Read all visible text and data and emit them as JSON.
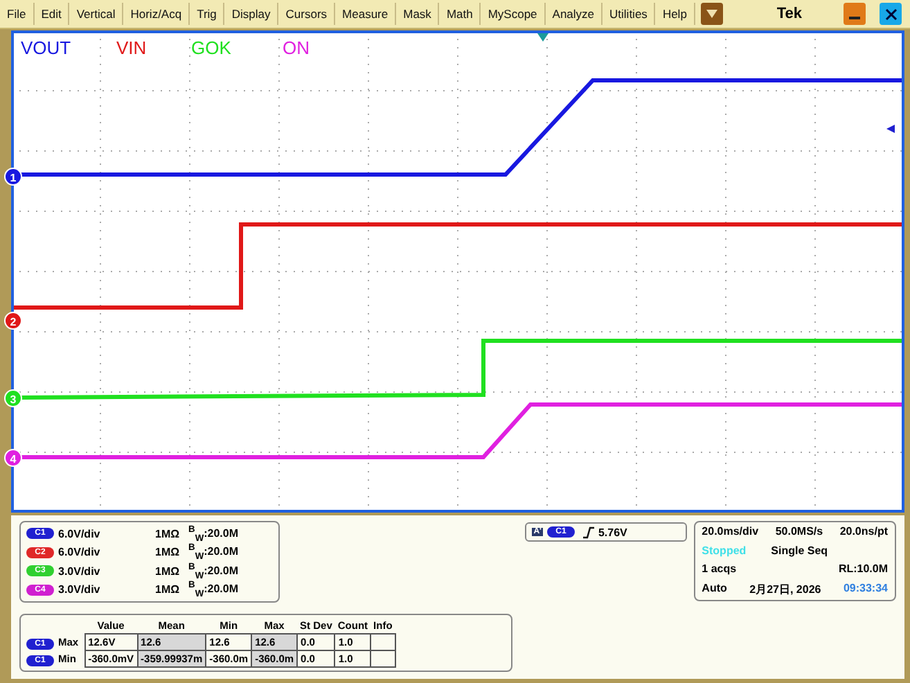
{
  "menu_bar": {
    "items": [
      "File",
      "Edit",
      "Vertical",
      "Horiz/Acq",
      "Trig",
      "Display",
      "Cursors",
      "Measure",
      "Mask",
      "Math",
      "MyScope",
      "Analyze",
      "Utilities",
      "Help"
    ],
    "brand": "Tek"
  },
  "plot": {
    "channels": [
      {
        "name": "VOUT",
        "marker": "1",
        "color": "#1818e0"
      },
      {
        "name": "VIN",
        "marker": "2",
        "color": "#e01818"
      },
      {
        "name": "GOK",
        "marker": "3",
        "color": "#20e020"
      },
      {
        "name": "ON",
        "marker": "4",
        "color": "#e020e0"
      }
    ]
  },
  "vertical_settings": [
    {
      "badge": "C1",
      "color": "#2020d0",
      "scale": "6.0V/div",
      "impedance": "1MΩ",
      "bandwidth": "$^{B}$$_{W}$:20.0M"
    },
    {
      "badge": "C2",
      "color": "#e02828",
      "scale": "6.0V/div",
      "impedance": "1MΩ",
      "bandwidth": "$^{B}$$_{W}$:20.0M"
    },
    {
      "badge": "C3",
      "color": "#30d030",
      "scale": "3.0V/div",
      "impedance": "1MΩ",
      "bandwidth": "$^{B}$$_{W}$:20.0M"
    },
    {
      "badge": "C4",
      "color": "#d020d0",
      "scale": "3.0V/div",
      "impedance": "1MΩ",
      "bandwidth": "$^{B}$$_{W}$:20.0M"
    }
  ],
  "trigger": {
    "mode_badge": "A'",
    "source": "C1",
    "color": "#2020d0",
    "level": "5.76V"
  },
  "timebase": {
    "scale": "20.0ms/div",
    "sample_rate": "50.0MS/s",
    "resolution": "20.0ns/pt",
    "state": "Stopped",
    "mode": "Single Seq",
    "acquisitions": "1 acqs",
    "record_length": "RL:10.0M",
    "trigger_mode": "Auto",
    "date": "2月27日, 2026",
    "time": "09:33:34"
  },
  "measurements": {
    "columns": [
      "Value",
      "Mean",
      "Min",
      "Max",
      "St Dev",
      "Count",
      "Info"
    ],
    "rows": [
      {
        "source": "C1",
        "color": "#2020d0",
        "label": "Max",
        "cells": [
          "12.6V",
          "12.6",
          "12.6",
          "12.6",
          "0.0",
          "1.0"
        ]
      },
      {
        "source": "C1",
        "color": "#2020d0",
        "label": "Min",
        "cells": [
          "-360.0mV",
          "-359.99937m",
          "-360.0m",
          "-360.0m",
          "0.0",
          "1.0"
        ]
      }
    ]
  }
}
